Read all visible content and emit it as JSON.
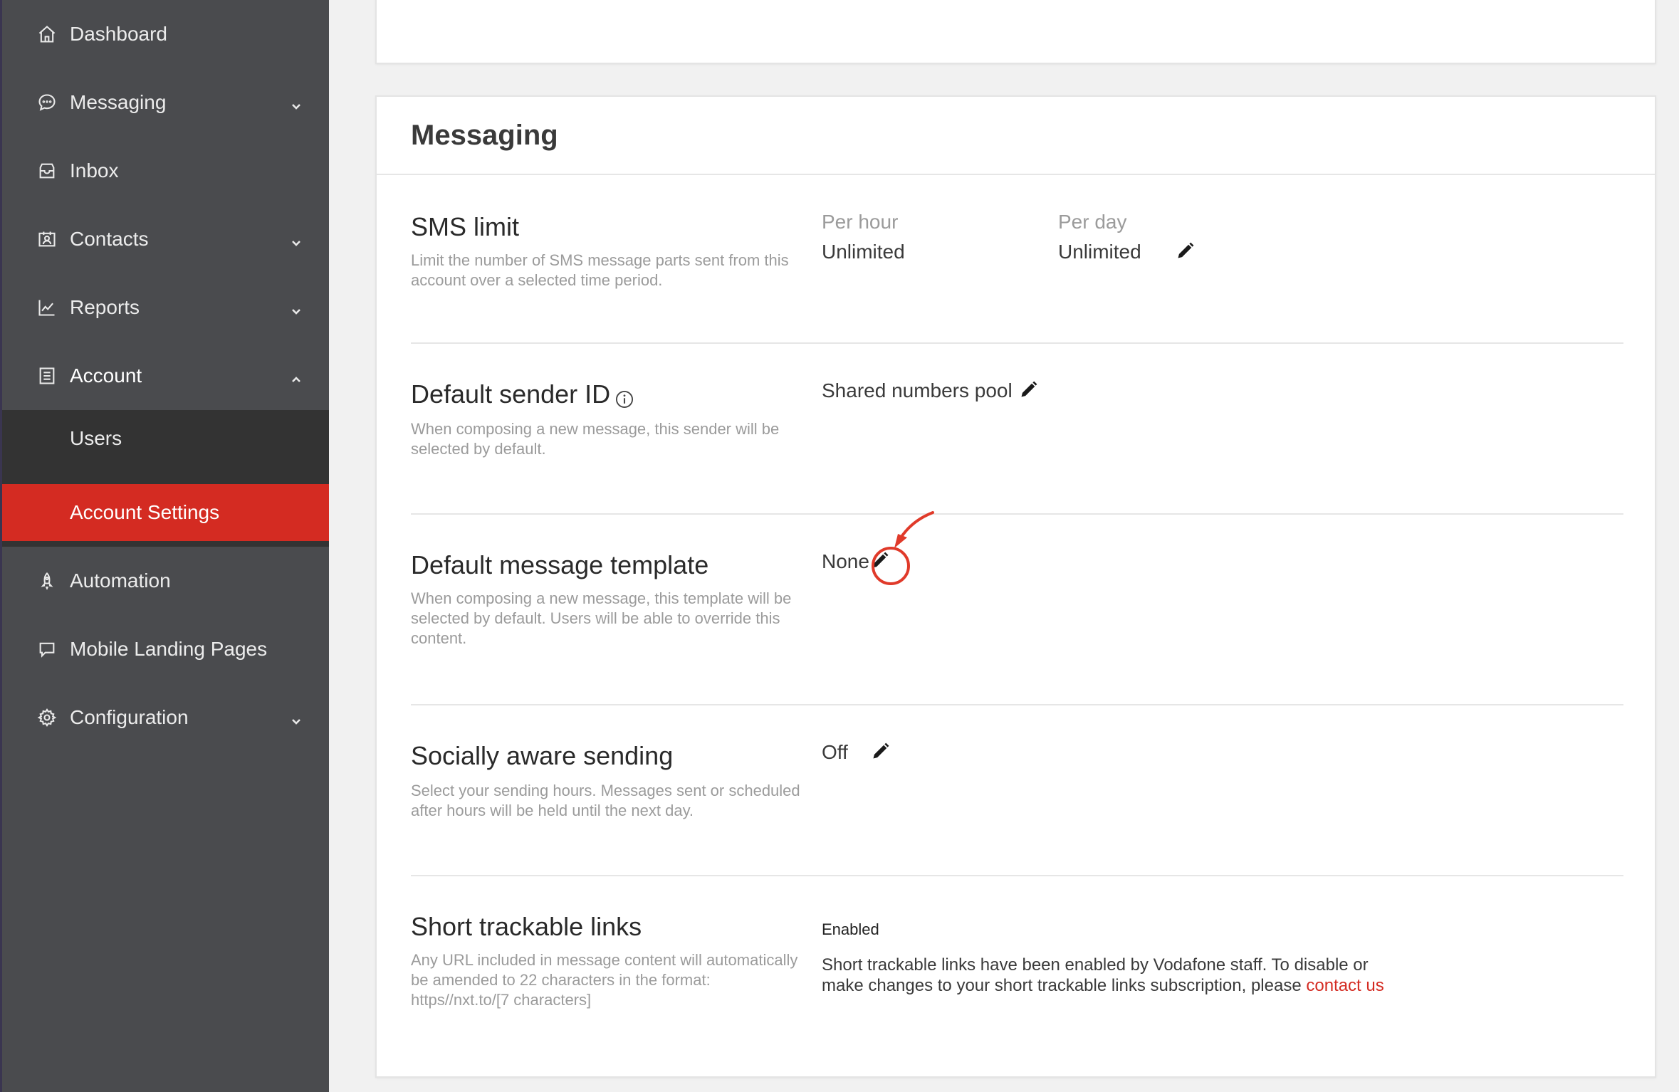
{
  "sidebar": {
    "items": [
      {
        "label": "Dashboard",
        "icon": "home-icon"
      },
      {
        "label": "Messaging",
        "icon": "chat-icon"
      },
      {
        "label": "Inbox",
        "icon": "inbox-icon"
      },
      {
        "label": "Contacts",
        "icon": "contacts-icon"
      },
      {
        "label": "Reports",
        "icon": "chart-line-icon"
      },
      {
        "label": "Account",
        "icon": "account-list-icon"
      },
      {
        "label": "Automation",
        "icon": "rocket-icon"
      },
      {
        "label": "Mobile Landing Pages",
        "icon": "landing-page-icon"
      },
      {
        "label": "Configuration",
        "icon": "gear-icon"
      }
    ],
    "account_sub": [
      {
        "label": "Users"
      },
      {
        "label": "Account Settings"
      }
    ]
  },
  "messaging_card": {
    "title": "Messaging",
    "sms_limit": {
      "title": "SMS limit",
      "desc": "Limit the number of SMS message parts sent from this account over a selected time period.",
      "per_hour_label": "Per hour",
      "per_hour_value": "Unlimited",
      "per_day_label": "Per day",
      "per_day_value": "Unlimited"
    },
    "sender_id": {
      "title": "Default sender ID",
      "desc": "When composing a new message, this sender will be selected by default.",
      "value": "Shared numbers pool"
    },
    "template": {
      "title": "Default message template",
      "desc": "When composing a new message, this template will be selected by default. Users will be able to override this content.",
      "value": "None"
    },
    "socially_aware": {
      "title": "Socially aware sending",
      "desc": "Select your sending hours. Messages sent or scheduled after hours will be held until the next day.",
      "value": "Off"
    },
    "short_links": {
      "title": "Short trackable links",
      "desc": "Any URL included in message content will automatically be amended to 22 characters in the format: https//nxt.to/[7 characters]",
      "status": "Enabled",
      "info_text": "Short trackable links have been enabled by Vodafone staff. To disable or make changes to your short trackable links subscription, please ",
      "link_text": "contact us"
    }
  },
  "colors": {
    "sidebar_bg": "#4a4b4e",
    "submenu_bg": "#333333",
    "accent_red": "#d42b22",
    "annotation_red": "#e03a2a"
  }
}
